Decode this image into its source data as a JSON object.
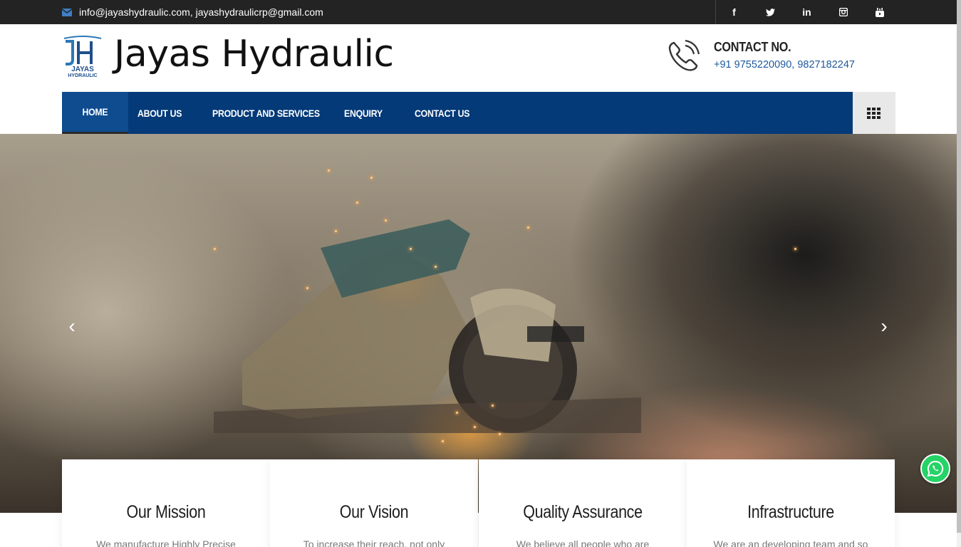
{
  "topbar": {
    "email": "info@jayashydraulic.com, jayashydraulicrp@gmail.com",
    "social": [
      {
        "icon": "facebook-icon",
        "glyph": "f"
      },
      {
        "icon": "twitter-icon",
        "glyph": "🐦"
      },
      {
        "icon": "linkedin-icon",
        "glyph": "in"
      },
      {
        "icon": "instagram-icon",
        "glyph": "◙"
      },
      {
        "icon": "youtube-icon",
        "glyph": "▶"
      }
    ]
  },
  "header": {
    "logo_line1": "JH",
    "logo_line2": "JAYAS",
    "logo_line3": "HYDRAULIC",
    "brand_name": "Jayas Hydraulic",
    "contact_title": "CONTACT NO.",
    "contact_numbers": "+91 9755220090, 9827182247"
  },
  "nav": {
    "items": [
      "HOME",
      "ABOUT US",
      "PRODUCT AND SERVICES",
      "ENQUIRY",
      "CONTACT US"
    ]
  },
  "hero": {
    "prev_glyph": "‹",
    "next_glyph": "›"
  },
  "cards": [
    {
      "title": "Our Mission",
      "text": "We manufacture Highly Precise"
    },
    {
      "title": "Our Vision",
      "text": "To increase their reach, not only"
    },
    {
      "title": "Quality Assurance",
      "text": "We believe all people who are"
    },
    {
      "title": "Infrastructure",
      "text": "We are an developing team and so"
    }
  ],
  "colors": {
    "nav_bg": "#053a78",
    "topbar_bg": "#232323",
    "accent_blue": "#1e5a9c",
    "whatsapp": "#25d366"
  }
}
